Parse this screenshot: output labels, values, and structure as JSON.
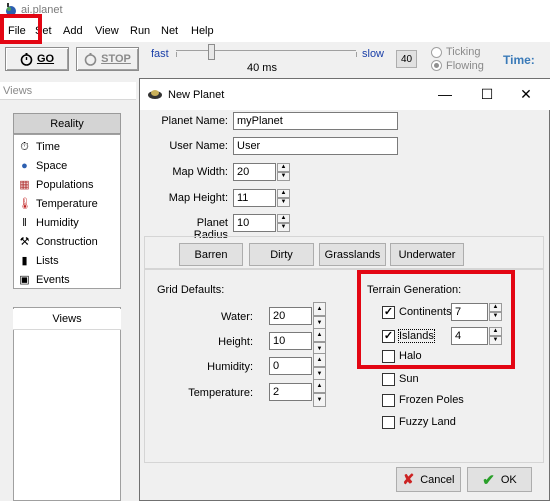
{
  "app": {
    "title": "ai.planet"
  },
  "menu": [
    "File",
    "Set",
    "Add",
    "View",
    "Run",
    "Net",
    "Help"
  ],
  "toolbar": {
    "go": "GO",
    "stop": "STOP",
    "fast": "fast",
    "slow": "slow",
    "delay": "40 ms",
    "step": "40",
    "ticking": "Ticking",
    "flowing": "Flowing",
    "time_label": "Time:"
  },
  "views_panel": {
    "header": "Views",
    "reality_button": "Reality",
    "items": [
      "Time",
      "Space",
      "Populations",
      "Temperature",
      "Humidity",
      "Construction",
      "Lists",
      "Events"
    ],
    "views_button": "Views"
  },
  "dialog": {
    "title": "New Planet",
    "fields": {
      "planet_name": {
        "label": "Planet Name:",
        "value": "myPlanet"
      },
      "user_name": {
        "label": "User Name:",
        "value": "User"
      },
      "map_width": {
        "label": "Map Width:",
        "value": "20"
      },
      "map_height": {
        "label": "Map Height:",
        "value": "11"
      },
      "planet_radius": {
        "label": "Planet Radius",
        "value": "10"
      }
    },
    "presets": [
      "Barren",
      "Dirty",
      "Grasslands",
      "Underwater"
    ],
    "grid_defaults": {
      "title": "Grid Defaults:",
      "water": {
        "label": "Water:",
        "value": "20"
      },
      "height": {
        "label": "Height:",
        "value": "10"
      },
      "humidity": {
        "label": "Humidity:",
        "value": "0"
      },
      "temperature": {
        "label": "Temperature:",
        "value": "2"
      }
    },
    "terrain": {
      "title": "Terrain Generation:",
      "continents": {
        "label": "Continents",
        "checked": true,
        "value": "7"
      },
      "islands": {
        "label": "Islands",
        "checked": true,
        "value": "4"
      },
      "halo": {
        "label": "Halo",
        "checked": false
      }
    },
    "options": {
      "sun": {
        "label": "Sun",
        "checked": false
      },
      "frozen_poles": {
        "label": "Frozen Poles",
        "checked": false
      },
      "fuzzy_land": {
        "label": "Fuzzy Land",
        "checked": false
      }
    },
    "cancel": "Cancel",
    "ok": "OK"
  },
  "colors": {
    "highlight": "#e30613",
    "ok_check": "#2aa02a",
    "cancel_x": "#cc2222"
  }
}
